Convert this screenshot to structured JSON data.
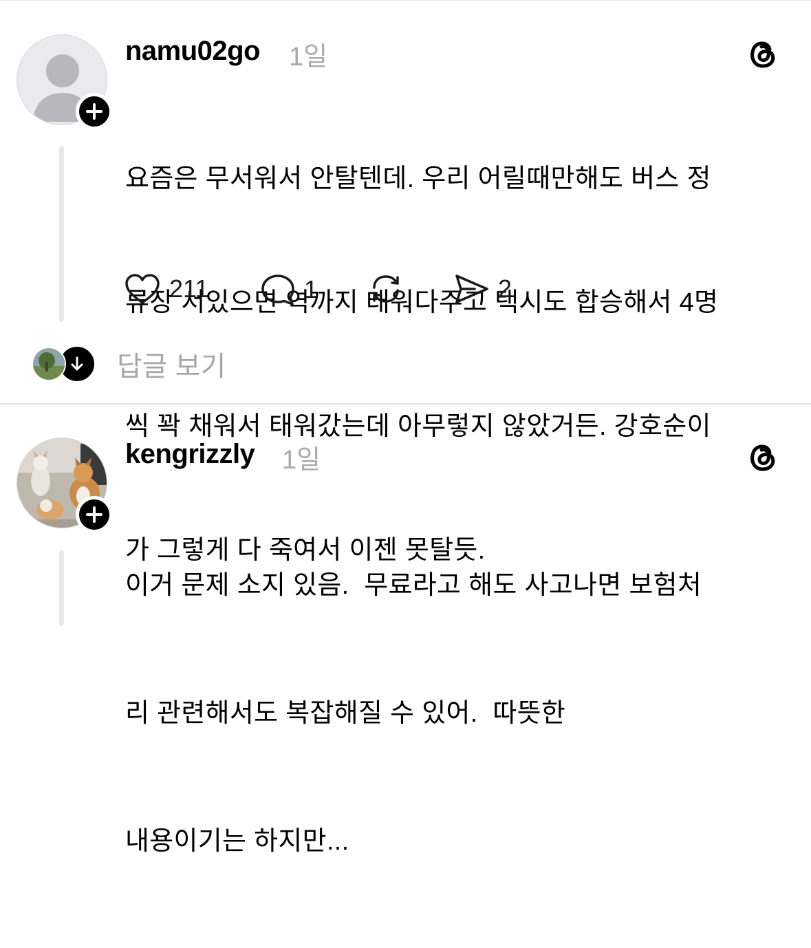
{
  "posts": [
    {
      "username": "namu02go",
      "time": "1일",
      "lines": [
        "요즘은 무서워서 안탈텐데. 우리 어릴때만해도 버스 정",
        "류장 서있으면 역까지 태워다주고 택시도 합승해서 4명",
        "씩 꽉 채워서 태워갔는데 아무렇지 않았거든. 강호순이",
        "가 그렇게 다 죽여서 이젠 못탈듯."
      ],
      "likes": "211",
      "comments": "1",
      "shares": "2",
      "view_replies": "답글 보기",
      "icons": [
        "avatar-default-icon",
        "plus-icon",
        "threads-logo-icon",
        "heart-icon",
        "comment-icon",
        "repost-icon",
        "share-icon",
        "arrow-down-icon"
      ]
    },
    {
      "username": "kengrizzly",
      "time": "1일",
      "lines": [
        "이거 문제 소지 있음.  무료라고 해도 사고나면 보험처",
        "리 관련해서도 복잡해질 수 있어.  따뜻한",
        "내용이기는 하지만..."
      ],
      "icons": [
        "cat-avatar-icon",
        "plus-icon",
        "threads-logo-icon"
      ]
    }
  ]
}
